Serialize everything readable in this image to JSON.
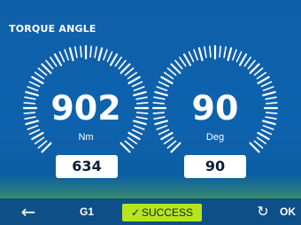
{
  "screen": {
    "title": "TORQUE ANGLE"
  },
  "gauges": [
    {
      "id": "torque",
      "value": "902",
      "unit": "Nm",
      "target": "634"
    },
    {
      "id": "angle",
      "value": "90",
      "unit": "Deg",
      "target": "90"
    }
  ],
  "footer": {
    "back_icon": "arrow-left-icon",
    "group": "G1",
    "status_check": "✓",
    "status": "SUCCESS",
    "redo_icon": "redo-icon",
    "ok": "OK"
  },
  "colors": {
    "background": "#0e62ad",
    "status_bg": "#b6e41f",
    "footer_bg": "#0d4f86",
    "text": "#ffffff"
  }
}
